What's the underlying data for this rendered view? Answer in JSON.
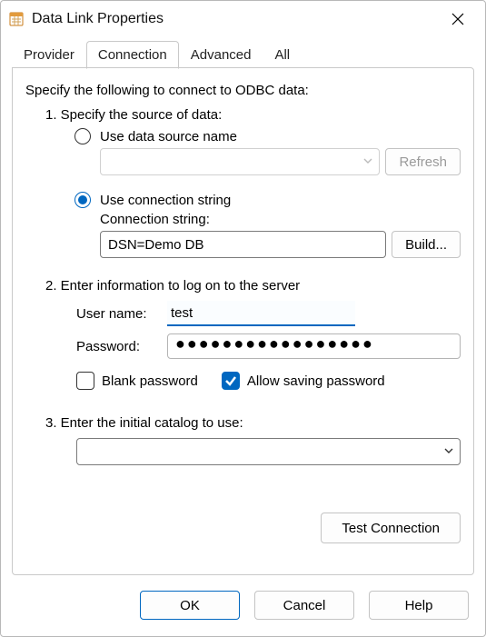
{
  "window": {
    "title": "Data Link Properties"
  },
  "tabs": {
    "provider": "Provider",
    "connection": "Connection",
    "advanced": "Advanced",
    "all": "All",
    "active": "connection"
  },
  "panel": {
    "intro": "Specify the following to connect to ODBC data:",
    "step1": "1. Specify the source of data:",
    "radio_dsn": "Use data source name",
    "refresh": "Refresh",
    "radio_cs": "Use connection string",
    "cs_label": "Connection string:",
    "cs_value": "DSN=Demo DB",
    "build": "Build...",
    "step2": "2. Enter information to log on to the server",
    "user_label": "User name:",
    "user_value": "test",
    "pwd_label": "Password:",
    "pwd_mask": "●●●●●●●●●●●●●●●●●",
    "chk_blank": "Blank password",
    "chk_save": "Allow saving password",
    "step3": "3. Enter the initial catalog to use:",
    "test": "Test Connection"
  },
  "footer": {
    "ok": "OK",
    "cancel": "Cancel",
    "help": "Help"
  },
  "icons": {
    "chevron_down": "chevron-down-icon",
    "close": "close-icon",
    "app": "app-icon"
  },
  "state": {
    "radio_selected": "connection_string",
    "blank_password_checked": false,
    "allow_saving_checked": true,
    "refresh_enabled": false,
    "dsn_combo_enabled": false
  }
}
